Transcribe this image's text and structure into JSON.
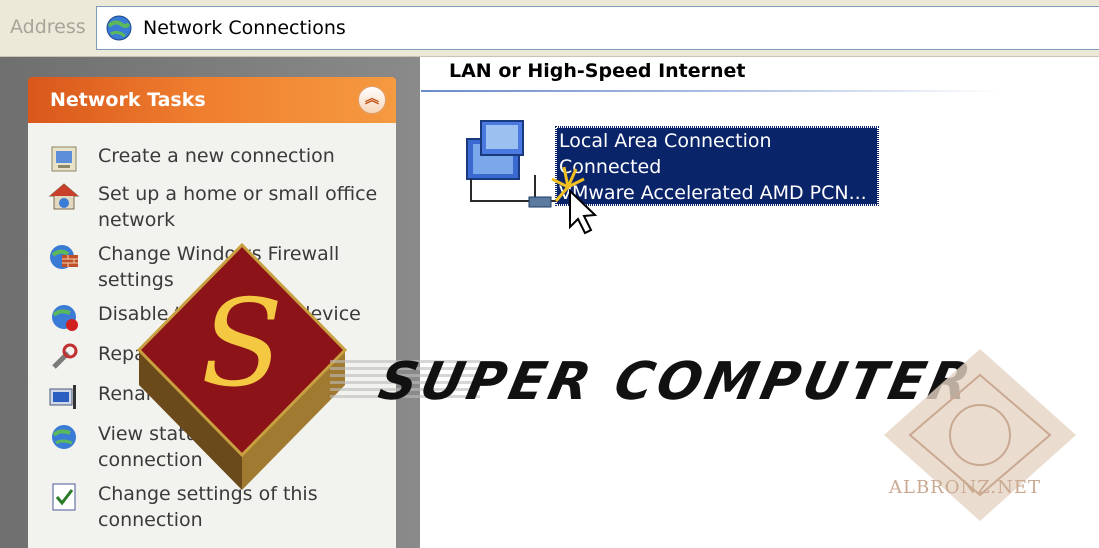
{
  "address_bar": {
    "label": "Address",
    "value": "Network Connections",
    "icon": "network-connections-icon"
  },
  "task_pane": {
    "title": "Network Tasks",
    "collapse_icon": "chevron-double-up-icon",
    "items": [
      {
        "label": "Create a new connection",
        "icon": "new-connection-icon"
      },
      {
        "label": "Set up a home or small office network",
        "icon": "home-network-icon"
      },
      {
        "label": "Change Windows Firewall settings",
        "icon": "firewall-icon"
      },
      {
        "label": "Disable this network device",
        "icon": "disable-device-icon"
      },
      {
        "label": "Repair this connection",
        "icon": "repair-icon"
      },
      {
        "label": "Rename this connection",
        "icon": "rename-icon"
      },
      {
        "label": "View status of this connection",
        "icon": "view-status-icon"
      },
      {
        "label": "Change settings of this connection",
        "icon": "settings-icon"
      }
    ]
  },
  "content": {
    "group_header": "LAN or High-Speed Internet",
    "connection": {
      "name": "Local Area Connection",
      "status": "Connected",
      "device": "VMware Accelerated AMD PCN...",
      "icon": "lan-connection-icon"
    }
  },
  "watermark": {
    "brand_text": "SUPER COMPUTER",
    "logo_letter": "S",
    "seal_text": "ALBRONZ.NET"
  }
}
